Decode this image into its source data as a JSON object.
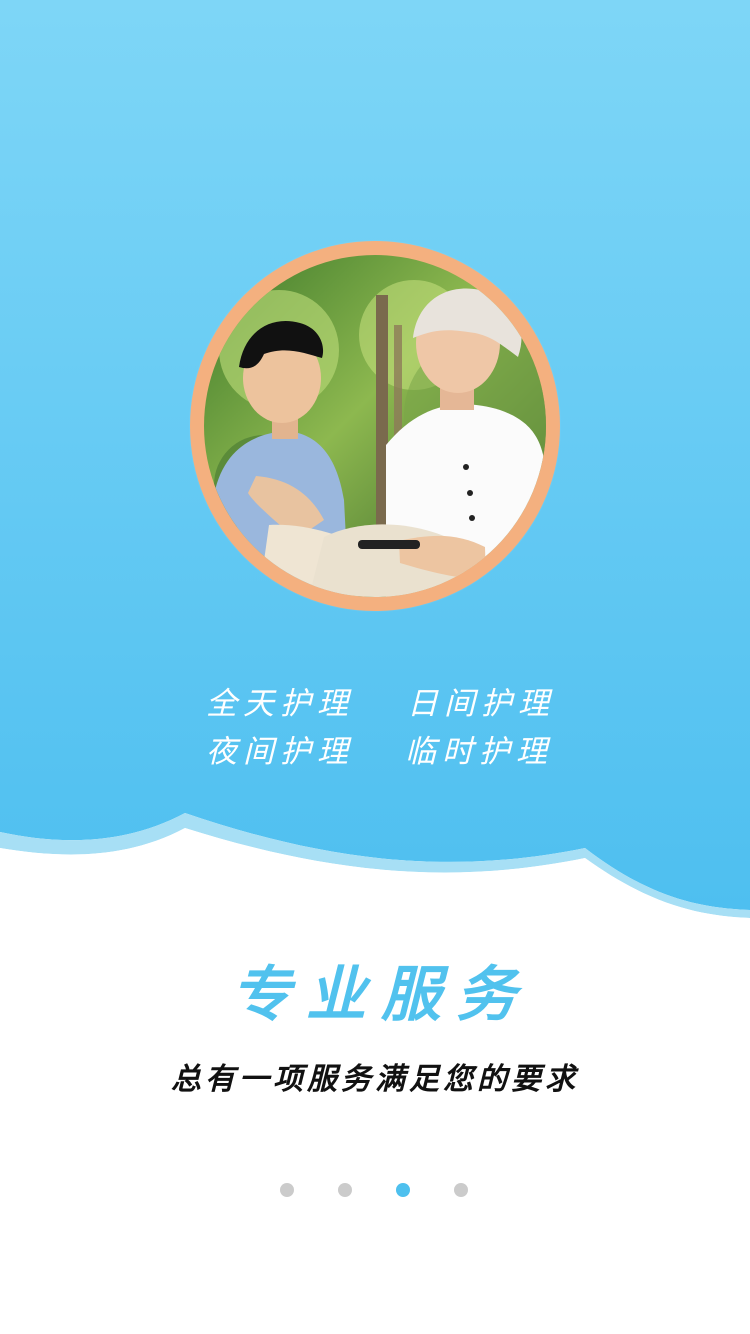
{
  "services": [
    {
      "label": "全天护理"
    },
    {
      "label": "日间护理"
    },
    {
      "label": "夜间护理"
    },
    {
      "label": "临时护理"
    }
  ],
  "title": "专业服务",
  "subtitle": "总有一项服务满足您的要求",
  "pagination": {
    "count": 4,
    "active_index": 2,
    "active_color": "#4ec0ee",
    "inactive_color": "#cbcbcb"
  },
  "colors": {
    "brand_blue": "#51c2ee",
    "sky_top": "#7dd5f7",
    "sky_bottom": "#4ec0f0",
    "ring": "#f4b07f"
  }
}
